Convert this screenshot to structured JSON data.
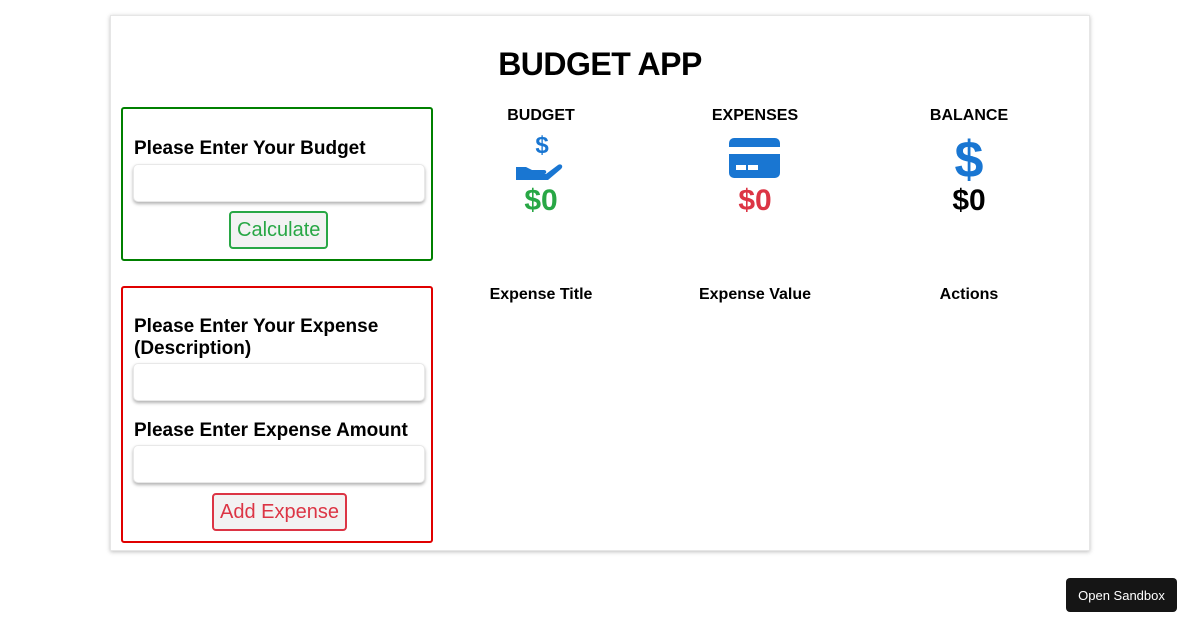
{
  "app": {
    "title": "BUDGET APP"
  },
  "budget_form": {
    "label": "Please Enter Your Budget",
    "input_value": "",
    "button_label": "Calculate"
  },
  "expense_form": {
    "description_label": "Please Enter Your Expense (Description)",
    "description_value": "",
    "amount_label": "Please Enter Expense Amount",
    "amount_value": "",
    "button_label": "Add Expense"
  },
  "stats": {
    "budget": {
      "label": "BUDGET",
      "value": "$0",
      "icon": "hand-dollar-icon",
      "color": "#28a745"
    },
    "expenses": {
      "label": "EXPENSES",
      "value": "$0",
      "icon": "credit-card-icon",
      "color": "#dc3545"
    },
    "balance": {
      "label": "BALANCE",
      "value": "$0",
      "icon": "dollar-icon",
      "color": "#000000"
    }
  },
  "expense_table": {
    "columns": [
      "Expense Title",
      "Expense Value",
      "Actions"
    ],
    "rows": []
  },
  "sandbox": {
    "label": "Open Sandbox"
  },
  "colors": {
    "icon_blue": "#1976d2",
    "green": "#28a745",
    "red": "#dc3545"
  }
}
